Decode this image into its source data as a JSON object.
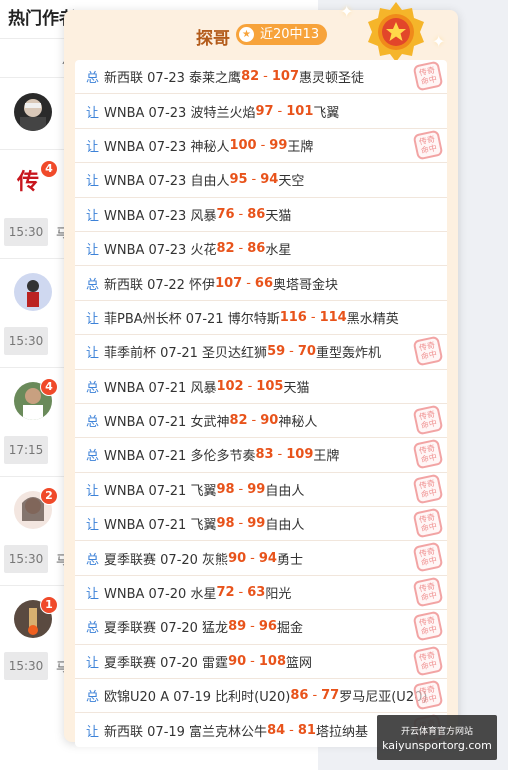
{
  "background": {
    "title": "热门作者",
    "subhead_char": "月",
    "rows": [
      {
        "time": "",
        "badge": ""
      },
      {
        "time": "15:30",
        "badge": "4",
        "frag": "马"
      },
      {
        "time": "15:30",
        "badge": "",
        "frag": ""
      },
      {
        "time": "17:15",
        "badge": "4",
        "frag": ""
      },
      {
        "time": "15:30",
        "badge": "2",
        "frag": "马"
      },
      {
        "time": "15:30",
        "badge": "1",
        "frag": "马"
      }
    ]
  },
  "popup": {
    "name": "探哥",
    "record": "近20中13",
    "stamp_text": [
      "传奇",
      "命中"
    ],
    "items": [
      {
        "type": "总",
        "text": "新西联 07-23 泰莱之鹰",
        "s1": "82",
        "s2": "107",
        "away": "惠灵顿圣徒",
        "hit": true
      },
      {
        "type": "让",
        "text": "WNBA 07-23 波特兰火焰",
        "s1": "97",
        "s2": "101",
        "away": "飞翼",
        "hit": false
      },
      {
        "type": "让",
        "text": "WNBA 07-23 神秘人",
        "s1": "100",
        "s2": "99",
        "away": "王牌",
        "hit": true
      },
      {
        "type": "让",
        "text": "WNBA 07-23 自由人",
        "s1": "95",
        "s2": "94",
        "away": "天空",
        "hit": false
      },
      {
        "type": "让",
        "text": "WNBA 07-23 风暴",
        "s1": "76",
        "s2": "86",
        "away": "天猫",
        "hit": false
      },
      {
        "type": "让",
        "text": "WNBA 07-23 火花",
        "s1": "82",
        "s2": "86",
        "away": "水星",
        "hit": false
      },
      {
        "type": "总",
        "text": "新西联 07-22 怀伊",
        "s1": "107",
        "s2": "66",
        "away": "奥塔哥金块",
        "hit": false
      },
      {
        "type": "让",
        "text": "菲PBA州长杯 07-21 博尔特斯",
        "s1": "116",
        "s2": "114",
        "away": "黑水精英",
        "hit": false
      },
      {
        "type": "让",
        "text": "菲季前杯 07-21 圣贝达红狮",
        "s1": "59",
        "s2": "70",
        "away": "重型轰炸机",
        "hit": true
      },
      {
        "type": "总",
        "text": "WNBA 07-21 风暴",
        "s1": "102",
        "s2": "105",
        "away": "天猫",
        "hit": false
      },
      {
        "type": "总",
        "text": "WNBA 07-21 女武神",
        "s1": "82",
        "s2": "90",
        "away": "神秘人",
        "hit": true
      },
      {
        "type": "总",
        "text": "WNBA 07-21 多伦多节奏",
        "s1": "83",
        "s2": "109",
        "away": "王牌",
        "hit": true
      },
      {
        "type": "让",
        "text": "WNBA 07-21 飞翼",
        "s1": "98",
        "s2": "99",
        "away": "自由人",
        "hit": true
      },
      {
        "type": "让",
        "text": "WNBA 07-21 飞翼",
        "s1": "98",
        "s2": "99",
        "away": "自由人",
        "hit": true
      },
      {
        "type": "总",
        "text": "夏季联赛 07-20 灰熊",
        "s1": "90",
        "s2": "94",
        "away": "勇士",
        "hit": true
      },
      {
        "type": "让",
        "text": "WNBA 07-20 水星",
        "s1": "72",
        "s2": "63",
        "away": "阳光",
        "hit": true
      },
      {
        "type": "总",
        "text": "夏季联赛 07-20 猛龙",
        "s1": "89",
        "s2": "96",
        "away": "掘金",
        "hit": true
      },
      {
        "type": "让",
        "text": "夏季联赛 07-20 雷霆",
        "s1": "90",
        "s2": "108",
        "away": "篮网",
        "hit": true
      },
      {
        "type": "总",
        "text": "欧锦U20 A 07-19 比利时(U20)",
        "s1": "86",
        "s2": "77",
        "away": "罗马尼亚(U20)",
        "hit": true
      },
      {
        "type": "让",
        "text": "新西联 07-19 富兰克林公牛",
        "s1": "84",
        "s2": "81",
        "away": "塔拉纳基",
        "hit": true
      }
    ]
  },
  "watermark": {
    "line1": "开云体育官方网站",
    "line2": "kaiyunsportorg.com"
  },
  "colors": {
    "accent": "#e8531b",
    "type": "#3d82d8",
    "pill": "#f7a33b"
  }
}
